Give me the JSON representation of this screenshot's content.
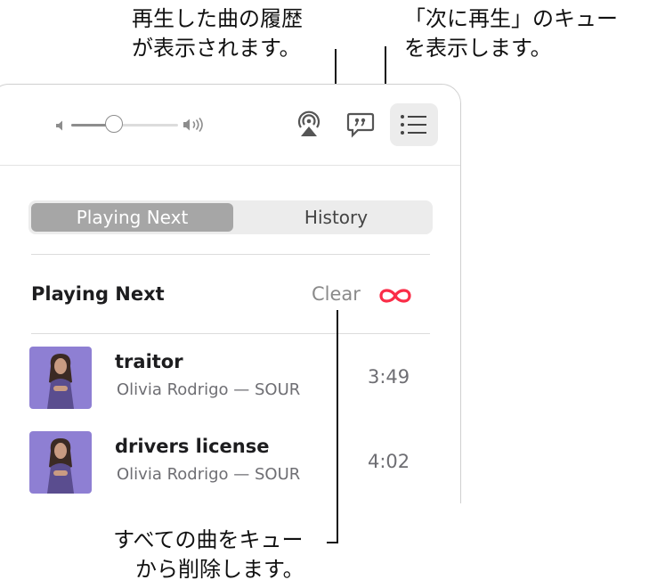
{
  "callouts": {
    "history": {
      "line1": "再生した曲の履歴",
      "line2": "が表示されます。"
    },
    "queue": {
      "line1": "「次に再生」のキュー",
      "line2": "を表示します。"
    },
    "clear": {
      "line1": "すべての曲をキュー",
      "line2": "から削除します。"
    }
  },
  "toolbar": {
    "icons": {
      "volume_low": "speaker-low-icon",
      "volume_high": "speaker-high-icon",
      "airplay": "airplay-icon",
      "lyrics": "lyrics-icon",
      "queue": "list-icon"
    },
    "volume_level": 0.4
  },
  "segmented": {
    "playing_next": "Playing Next",
    "history": "History",
    "selected": "Playing Next"
  },
  "queue_section": {
    "title": "Playing Next",
    "clear_label": "Clear",
    "autoplay_icon": "infinity-icon"
  },
  "songs": [
    {
      "title": "traitor",
      "subtitle": "Olivia Rodrigo — SOUR",
      "duration": "3:49"
    },
    {
      "title": "drivers license",
      "subtitle": "Olivia Rodrigo — SOUR",
      "duration": "4:02"
    }
  ],
  "colors": {
    "accent": "#fa2d48",
    "album_art_bg": "#8e7fd3"
  }
}
